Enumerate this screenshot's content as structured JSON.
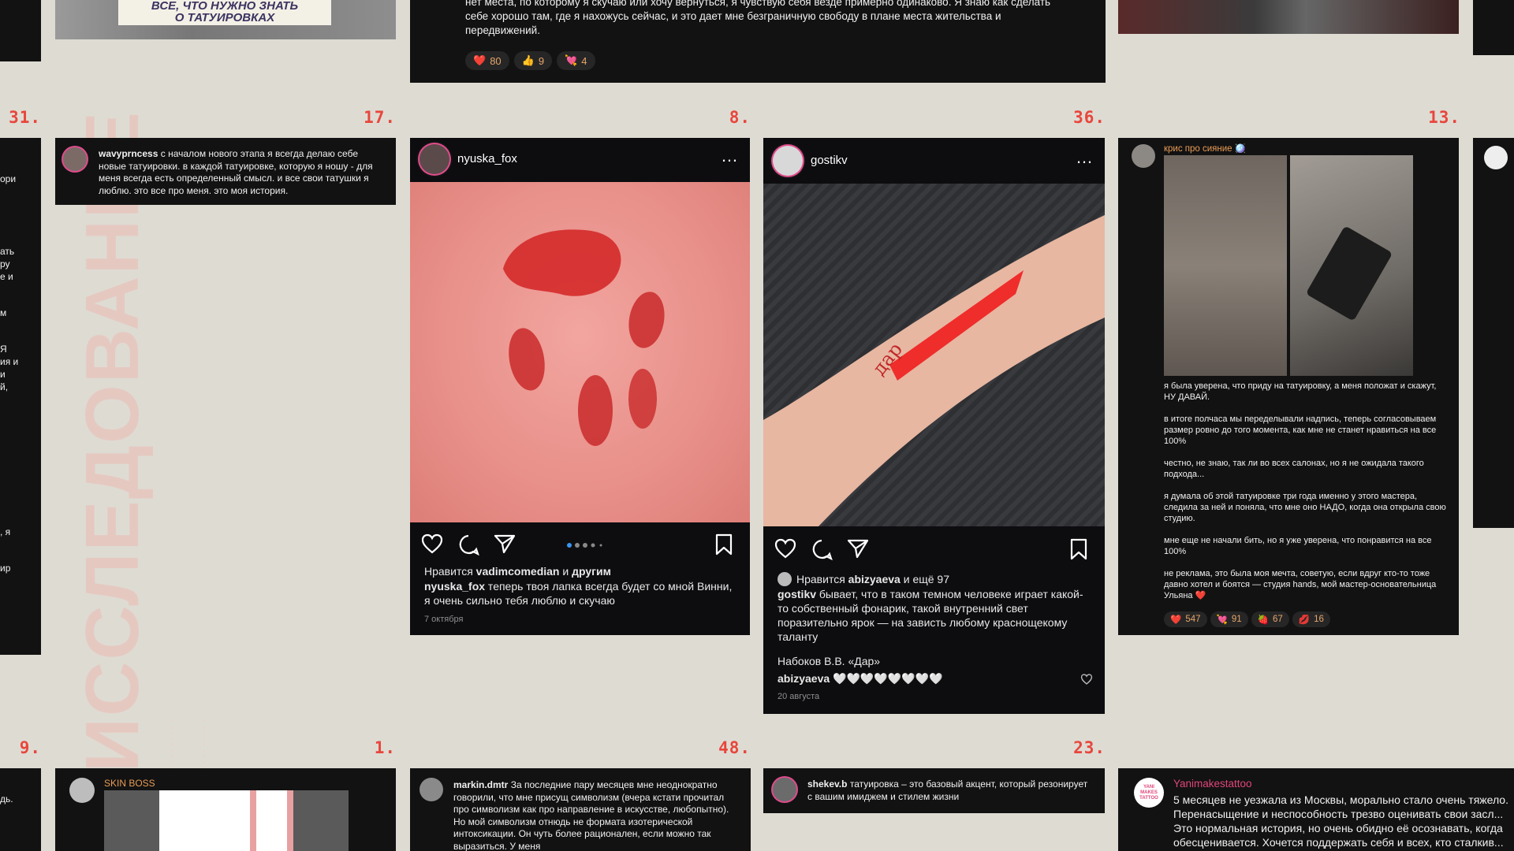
{
  "numbers": [
    "31.",
    "17.",
    "8.",
    "36.",
    "13.",
    "9.",
    "1.",
    "48.",
    "23."
  ],
  "background_heading": "ИССЛЕДОВАНИЕ",
  "top_left_card": {
    "banner_line1": "ВСЕ, ЧТО НУЖНО ЗНАТЬ",
    "banner_line2": "О ТАТУИРОВКАХ"
  },
  "top_mid_card": {
    "text": "нет места, по которому я скучаю или хочу вернуться, я чувствую себя везде примерно одинаково. Я знаю как сделать себе хорошо там, где я нахожусь сейчас, и это дает мне безграничную свободу в плане места жительства и передвижений.",
    "reactions": [
      {
        "emoji": "❤️",
        "count": "80"
      },
      {
        "emoji": "👍",
        "count": "9"
      },
      {
        "emoji": "💘",
        "count": "4"
      }
    ]
  },
  "left_strip": {
    "fragments": [
      "ори",
      "ать",
      "ру",
      "е и",
      "м",
      "Я",
      "ия и",
      "и",
      "й,",
      ", я",
      "ир",
      "дь."
    ]
  },
  "wavy_card": {
    "username": "wavyprncess",
    "text": "с началом нового этапа я всегда делаю себе новые татуировки. в каждой татуировке, которую я ношу - для меня всегда есть определенный смысл. и все свои татушки я люблю. это все про меня. это моя история."
  },
  "nyuska_post": {
    "username": "nyuska_fox",
    "more_icon": "…",
    "liked_prefix": "Нравится ",
    "liked_user": "vadimcomedian",
    "liked_suffix": " и ",
    "liked_others": "другим",
    "caption_user": "nyuska_fox",
    "caption": " теперь твоя лапка всегда будет со мной Винни, я очень сильно тебя люблю и скучаю",
    "date": "7 октября"
  },
  "gostikv_post": {
    "username": "gostikv",
    "more_icon": "…",
    "liked_prefix": "Нравится ",
    "liked_user": "abizyaeva",
    "liked_suffix": " и ещё 97",
    "caption_user": "gostikv",
    "caption": " бывает, что в таком темном человеке играет какой-то собственный фонарик, такой внутренний свет поразительно ярок — на зависть любому краснощекому таланту",
    "quote": "Набоков В.В. «Дар»",
    "comment_user": "abizyaeva",
    "comment": " 🤍🤍🤍🤍🤍🤍🤍🤍",
    "date": "20 августа",
    "tattoo_word": "дар"
  },
  "kris_card": {
    "username": "крис про сияние 🪩",
    "paragraphs": [
      "я была уверена, что приду на татуировку, а меня положат и скажут, НУ ДАВАЙ.",
      "в итоге полчаса мы переделывали надпись, теперь согласовываем размер ровно до того момента, как мне не станет нравиться на все 100%",
      "честно, не знаю, так ли во всех салонах, но я не ожидала такого подхода...",
      "я думала об этой татуировке три года именно у этого мастера, следила за ней и поняла, что мне оно НАДО, когда она открыла свою студию.",
      "мне еще не начали бить, но я уже уверена, что понравится на все 100%",
      "не реклама, это была моя мечта, советую, если вдруг кто-то тоже давно хотел и боятся — студия hands, мой мастер-основательница Ульяна ❤️"
    ],
    "reactions": [
      {
        "emoji": "❤️",
        "count": "547"
      },
      {
        "emoji": "💘",
        "count": "91"
      },
      {
        "emoji": "🍓",
        "count": "67"
      },
      {
        "emoji": "💋",
        "count": "16"
      }
    ]
  },
  "skin_card": {
    "username": "SKIN BOSS"
  },
  "markin_card": {
    "username": "markin.dmtr",
    "text": "За последние пару месяцев мне неоднократно говорили, что мне присущ символизм (вчера кстати прочитал про символизм как про направление в искусстве, любопытно). Но мой символизм отнюдь не формата изотерической интоксикации. Он чуть более рационален, если можно так выразиться. У меня"
  },
  "shekev_card": {
    "username": "shekev.b",
    "text": "татуировка – это базовый акцент, который резонирует с вашим имиджем и стилем жизни"
  },
  "yani_card": {
    "username": "Yanimakestattoo",
    "avatar_text": "YANI MAKES TATTOO",
    "text": "5 месяцев не уезжала из Москвы, морально стало очень тяжело. Перенасыщение и неспособность трезво оценивать свои засл... Это нормальная история, но очень обидно её осознавать, когда обесценивается. Хочется поддержать себя и всех, кто сталкив..."
  },
  "colors": {
    "accent": "#e8463c",
    "bg": "#dedbd3",
    "card": "#121212"
  }
}
